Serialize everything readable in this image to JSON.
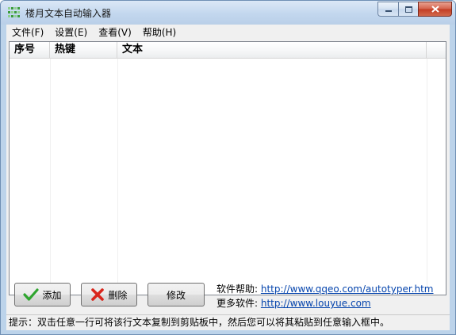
{
  "window": {
    "title": "楼月文本自动输入器"
  },
  "menu": [
    "文件(F)",
    "设置(E)",
    "查看(V)",
    "帮助(H)"
  ],
  "list": {
    "columns": [
      "序号",
      "热键",
      "文本",
      ""
    ],
    "rows": []
  },
  "buttons": {
    "add": "添加",
    "delete": "删除",
    "edit": "修改"
  },
  "links": {
    "help_label": "软件帮助:",
    "help_url": "http://www.qqeo.com/autotyper.htm",
    "more_label": "更多软件:",
    "more_url": "http://www.louyue.com"
  },
  "status": "提示：双击任意一行可将该行文本复制到剪贴板中，然后您可以将其粘贴到任意输入框中。",
  "colors": {
    "link": "#0645ad",
    "add_check": "#2fa52f",
    "delete_x": "#d9261c"
  }
}
